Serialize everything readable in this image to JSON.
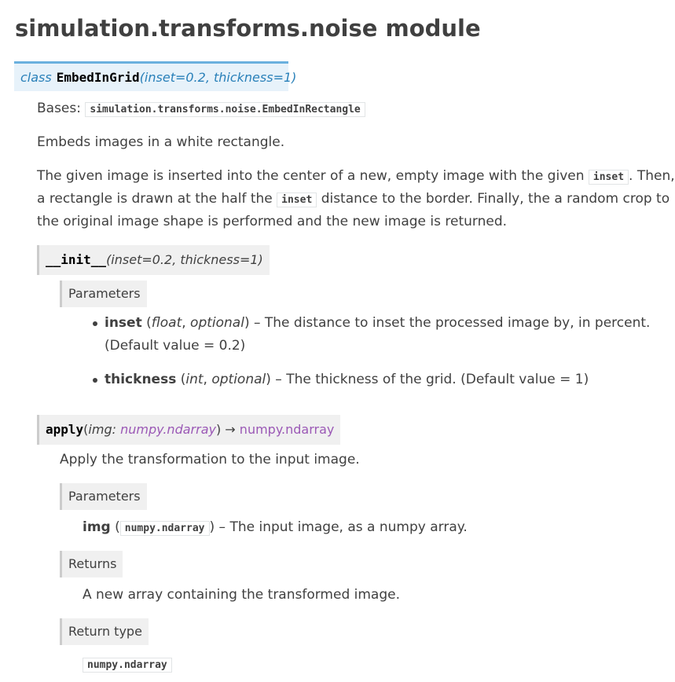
{
  "page_title": "simulation.transforms.noise module",
  "class_sig": {
    "keyword": "class",
    "name": "EmbedInGrid",
    "params": "(inset=0.2, thickness=1)"
  },
  "bases": {
    "label": "Bases:",
    "value": "simulation.transforms.noise.EmbedInRectangle"
  },
  "summary": "Embeds images in a white rectangle.",
  "description": {
    "part1": "The given image is inserted into the center of a new, empty image with the given",
    "code1": "inset",
    "part2": ". Then,",
    "part3": "a rectangle is drawn at the half the",
    "code2": "inset",
    "part4": "distance to the border. Finally, the a random crop to",
    "part5": "the original image shape is performed and the new image is returned."
  },
  "init_method": {
    "name": "__init__",
    "params": "(inset=0.2, thickness=1)",
    "parameters_label": "Parameters",
    "params_list": [
      {
        "name": "inset",
        "open": " (",
        "type": "float",
        "sep": ", ",
        "opt": "optional",
        "desc": ") – The distance to inset the processed image by, in percent.",
        "desc2": "(Default value = 0.2)"
      },
      {
        "name": "thickness",
        "open": " (",
        "type": "int",
        "sep": ", ",
        "opt": "optional",
        "desc": ") – The thickness of the grid. (Default value = 1)"
      }
    ]
  },
  "apply_method": {
    "name": "apply",
    "param_open": "(",
    "param_name": "img:",
    "param_type": "numpy.ndarray",
    "param_close": ")",
    "arrow": " → ",
    "return_type": "numpy.ndarray",
    "summary": "Apply the transformation to the input image.",
    "parameters_label": "Parameters",
    "param_item_name": "img",
    "param_item_open": " (",
    "param_item_type": "numpy.ndarray",
    "param_item_desc": ") – The input image, as a numpy array.",
    "returns_label": "Returns",
    "returns_text": "A new array containing the transformed image.",
    "return_type_label": "Return type",
    "return_type_value": "numpy.ndarray"
  },
  "colors": {
    "link": "#2980b9",
    "type": "#9b59b6",
    "sig_bg": "#e7f2fa",
    "sig_border": "#6ab0de",
    "field_bg": "#f0f0f0"
  }
}
